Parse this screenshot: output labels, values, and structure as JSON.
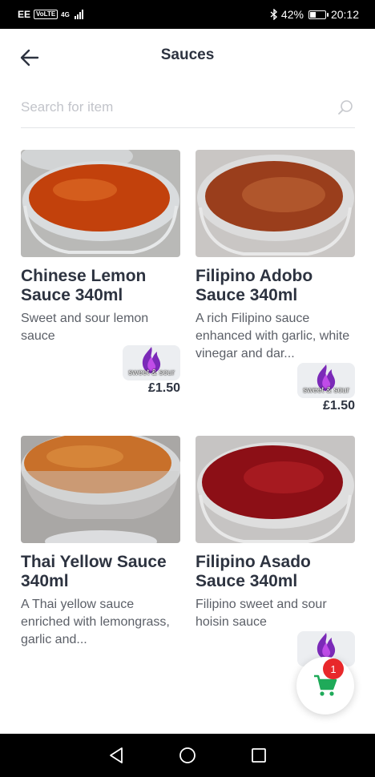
{
  "status_bar": {
    "carrier": "EE",
    "volte": "VoLTE",
    "network": "4G",
    "battery": "42%",
    "battery_level": 0.42,
    "time": "20:12"
  },
  "header": {
    "title": "Sauces",
    "back_icon": "arrow-left-icon"
  },
  "search": {
    "placeholder": "Search for item",
    "value": ""
  },
  "items": [
    {
      "name": "Chinese Lemon Sauce 340ml",
      "description": "Sweet and sour lemon sauce",
      "tag": "sweet & sour",
      "price": "£1.50",
      "sauce_color": "#c2410c",
      "sauce_highlight": "#e0702a"
    },
    {
      "name": "Filipino Adobo Sauce 340ml",
      "description": "A rich Filipino sauce enhanced with garlic, white vinegar and dar...",
      "tag": "sweet & sour",
      "price": "£1.50",
      "sauce_color": "#9a3e1c",
      "sauce_highlight": "#c26a3a"
    },
    {
      "name": "Thai Yellow Sauce 340ml",
      "description": "A Thai yellow sauce enriched with lemongrass, garlic and...",
      "tag": "",
      "price": "",
      "sauce_color": "#c8702a",
      "sauce_highlight": "#e09244"
    },
    {
      "name": "Filipino Asado Sauce 340ml",
      "description": "Filipino sweet and sour hoisin sauce",
      "tag": "",
      "price": "",
      "sauce_color": "#8c0f16",
      "sauce_highlight": "#b82228"
    }
  ],
  "cart": {
    "count": "1",
    "icon": "shopping-cart-icon",
    "color": "#1faa59"
  },
  "nav": {
    "back": "triangle-back-icon",
    "home": "circle-home-icon",
    "recents": "square-recents-icon"
  }
}
